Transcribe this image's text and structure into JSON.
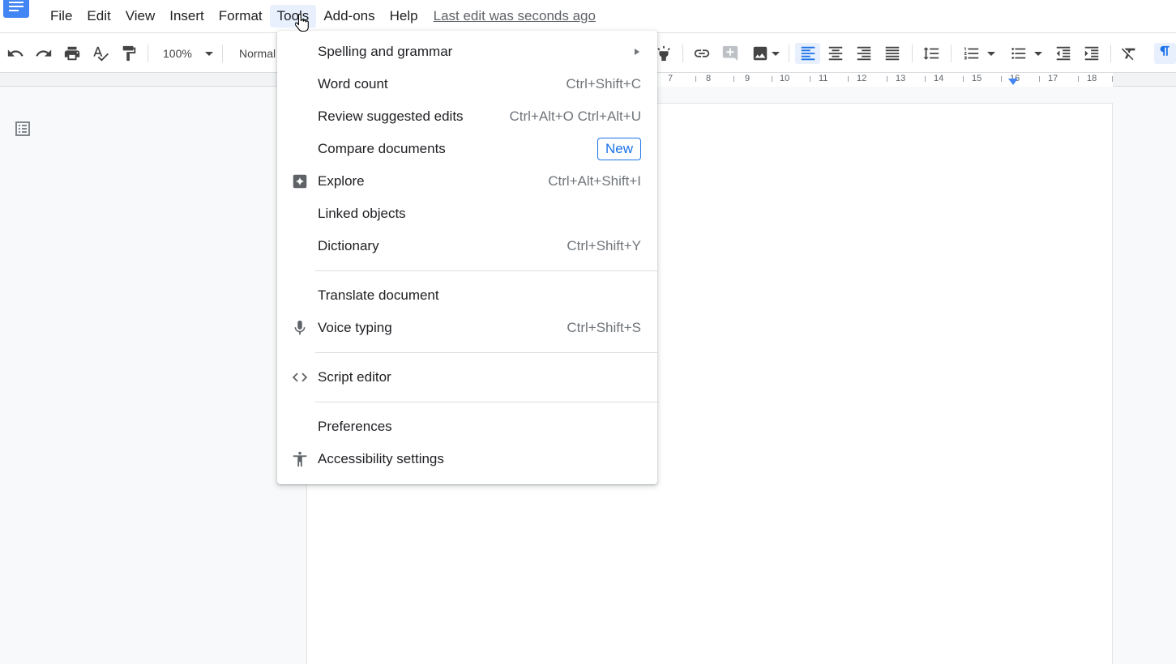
{
  "menubar": {
    "items": [
      "File",
      "Edit",
      "View",
      "Insert",
      "Format",
      "Tools",
      "Add-ons",
      "Help"
    ],
    "active": "Tools",
    "last_edit": "Last edit was seconds ago"
  },
  "toolbar": {
    "zoom": "100%",
    "style": "Normal"
  },
  "ruler": {
    "ticks": [
      "7",
      "8",
      "9",
      "10",
      "11",
      "12",
      "13",
      "14",
      "15",
      "16",
      "17",
      "18"
    ]
  },
  "tools_menu": {
    "spelling": "Spelling and grammar",
    "word_count": "Word count",
    "word_count_sc": "Ctrl+Shift+C",
    "review": "Review suggested edits",
    "review_sc": "Ctrl+Alt+O Ctrl+Alt+U",
    "compare": "Compare documents",
    "compare_badge": "New",
    "explore": "Explore",
    "explore_sc": "Ctrl+Alt+Shift+I",
    "linked": "Linked objects",
    "dictionary": "Dictionary",
    "dictionary_sc": "Ctrl+Shift+Y",
    "translate": "Translate document",
    "voice": "Voice typing",
    "voice_sc": "Ctrl+Shift+S",
    "script": "Script editor",
    "preferences": "Preferences",
    "accessibility": "Accessibility settings"
  },
  "colors": {
    "accent": "#1a73e8",
    "logo": "#4285f4",
    "active_menu_bg": "#e8f0fe"
  }
}
